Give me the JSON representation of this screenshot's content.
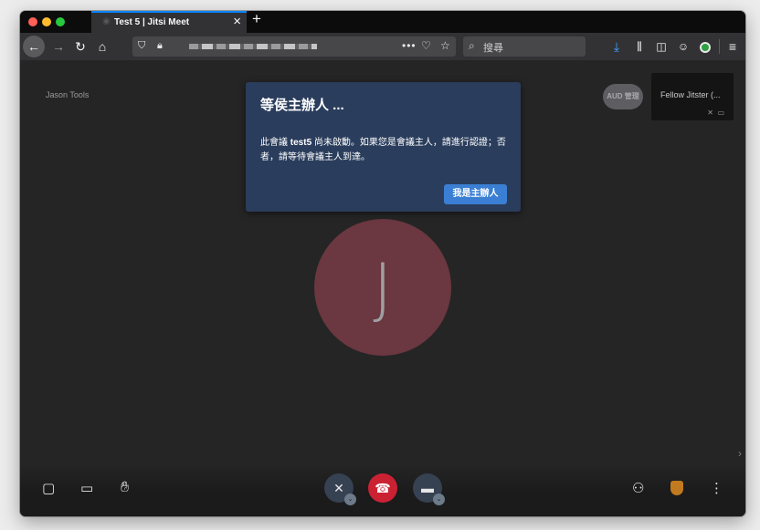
{
  "browser": {
    "tab_title": "Test 5 | Jitsi Meet",
    "tab_close": "×",
    "new_tab": "+",
    "url_actions": "•••",
    "search_placeholder": "搜尋"
  },
  "meeting": {
    "local_name": "Jason Tools",
    "thumbnails": [
      {
        "label": "AUD 管理"
      },
      {
        "label": "Fellow Jitster (..."
      }
    ],
    "avatar_initial": "J"
  },
  "dialog": {
    "title": "等侯主辦人 ...",
    "body_prefix": "此會議 ",
    "body_room": "test5",
    "body_suffix": " 尚未啟動。如果您是會議主人，請進行認證；否者，請等待會議主人到達。",
    "button_label": "我是主辦人"
  },
  "colors": {
    "dialog_bg": "#2a3d5c",
    "dialog_button": "#3a7fd3",
    "hangup": "#cb2233",
    "avatar": "#6b3740",
    "tab_accent": "#0a84ff",
    "download": "#45a1ff"
  },
  "icons": {
    "back": "arrow-left-icon",
    "forward": "arrow-right-icon",
    "reload": "reload-icon",
    "home": "home-icon",
    "shield": "tracking-shield-icon",
    "lock": "lock-icon",
    "pocket": "pocket-icon",
    "bookmark": "star-icon",
    "search": "search-icon",
    "download": "download-icon",
    "library": "library-icon",
    "sidebar": "sidebar-icon",
    "account": "account-icon",
    "extension": "extension-icon",
    "menu": "hamburger-menu-icon",
    "chat": "chat-icon",
    "screenshare": "screen-share-icon",
    "raise_hand": "raise-hand-icon",
    "mic_muted": "mic-muted-icon",
    "hangup": "hangup-icon",
    "camera_off": "camera-off-icon",
    "invite": "invite-people-icon",
    "security": "security-shield-icon",
    "more": "more-vertical-icon",
    "filmstrip_toggle": "chevron-right-icon"
  }
}
